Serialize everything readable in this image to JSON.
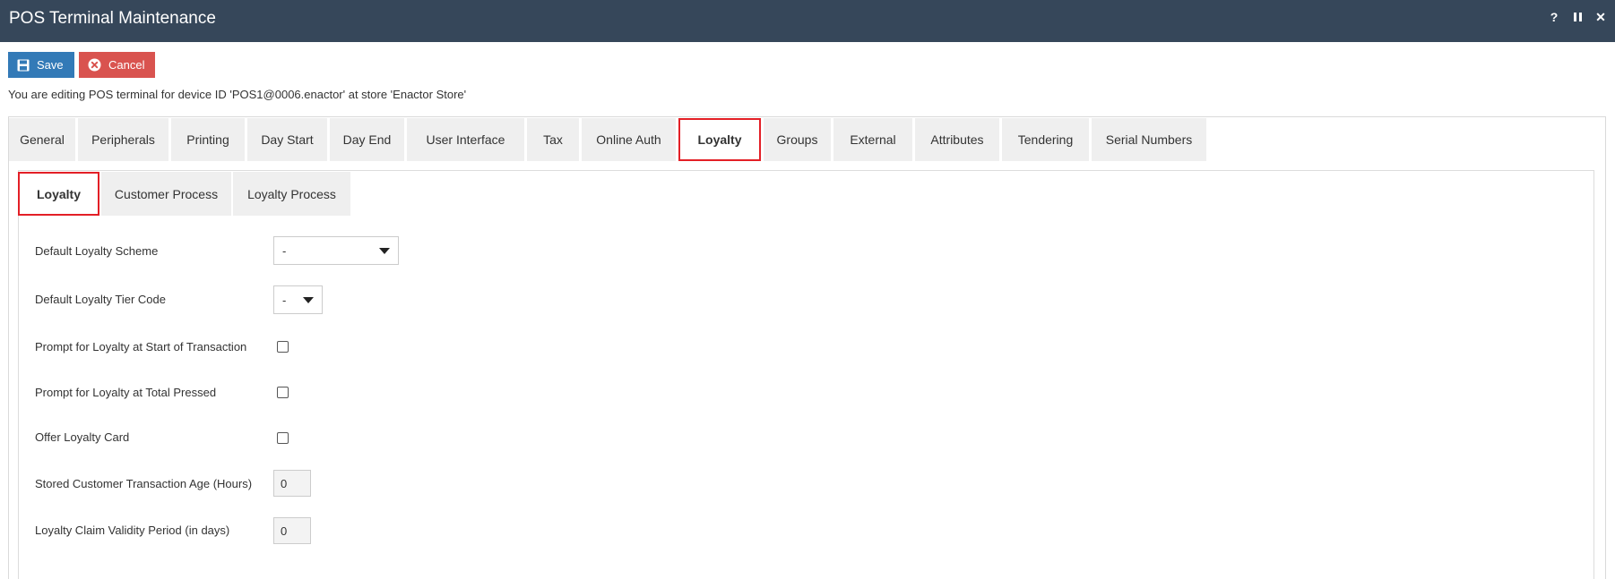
{
  "window": {
    "title": "POS Terminal Maintenance",
    "help_label": "?",
    "close_label": "✕"
  },
  "toolbar": {
    "save_label": "Save",
    "cancel_label": "Cancel"
  },
  "info_text": "You are editing POS terminal for device ID 'POS1@0006.enactor' at store 'Enactor Store'",
  "tabs": [
    {
      "label": "General"
    },
    {
      "label": "Peripherals"
    },
    {
      "label": "Printing"
    },
    {
      "label": "Day Start"
    },
    {
      "label": "Day End"
    },
    {
      "label": "User Interface"
    },
    {
      "label": "Tax"
    },
    {
      "label": "Online Auth"
    },
    {
      "label": "Loyalty",
      "active": true
    },
    {
      "label": "Groups"
    },
    {
      "label": "External"
    },
    {
      "label": "Attributes"
    },
    {
      "label": "Tendering"
    },
    {
      "label": "Serial Numbers"
    }
  ],
  "subtabs": [
    {
      "label": "Loyalty",
      "active": true
    },
    {
      "label": "Customer Process"
    },
    {
      "label": "Loyalty Process"
    }
  ],
  "form": {
    "default_loyalty_scheme": {
      "label": "Default Loyalty Scheme",
      "value": "-"
    },
    "default_loyalty_tier_code": {
      "label": "Default Loyalty Tier Code",
      "value": "-"
    },
    "prompt_start": {
      "label": "Prompt for Loyalty at Start of Transaction",
      "checked": false
    },
    "prompt_total": {
      "label": "Prompt for Loyalty at Total Pressed",
      "checked": false
    },
    "offer_card": {
      "label": "Offer Loyalty Card",
      "checked": false
    },
    "stored_age": {
      "label": "Stored Customer Transaction Age (Hours)",
      "value": "0"
    },
    "claim_validity": {
      "label": "Loyalty Claim Validity Period (in days)",
      "value": "0"
    }
  },
  "colors": {
    "titlebar": "#36475a",
    "save": "#337ab7",
    "cancel": "#d9534f",
    "active_tab_border": "#e31f26"
  }
}
